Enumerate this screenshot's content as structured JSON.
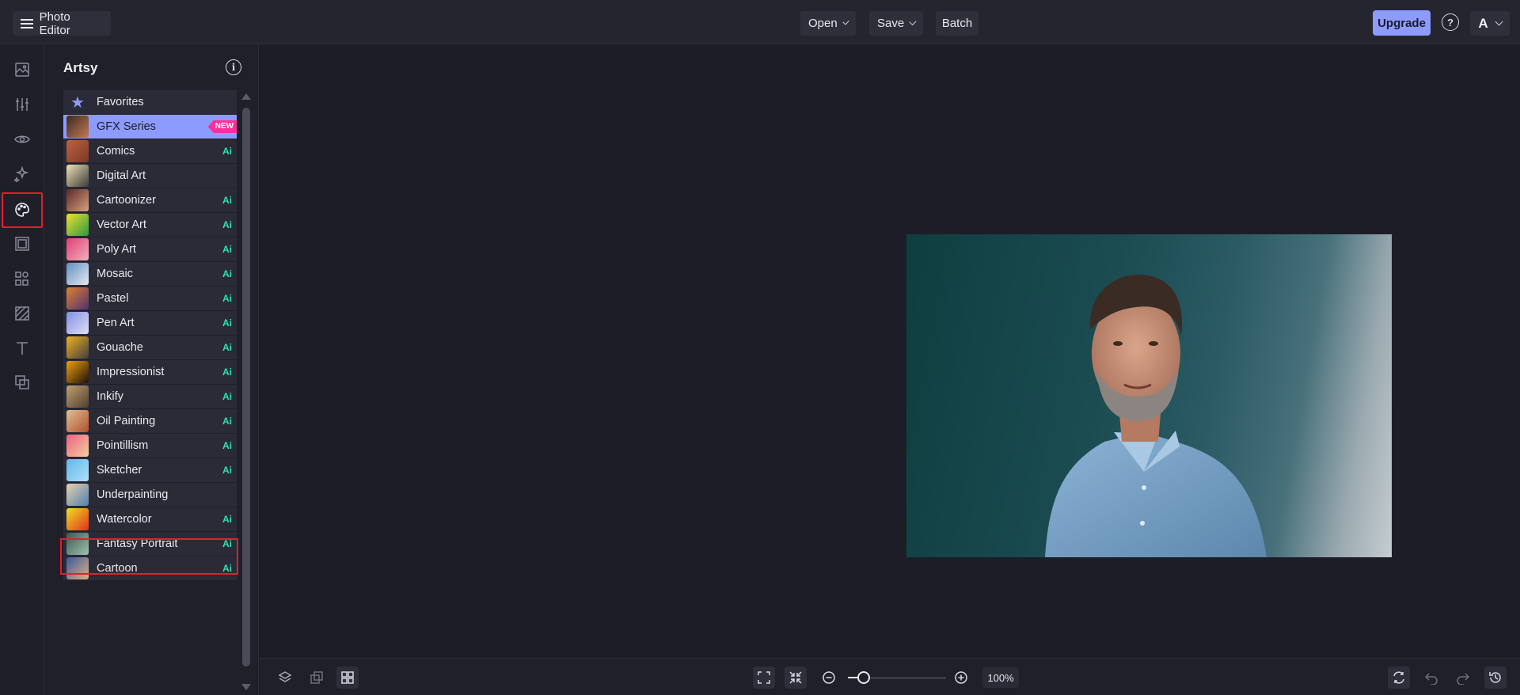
{
  "header": {
    "menu_label": "Photo Editor",
    "open_label": "Open",
    "save_label": "Save",
    "batch_label": "Batch",
    "upgrade_label": "Upgrade",
    "help_label": "?",
    "account_initial": "A"
  },
  "rail": {
    "icons": [
      "image-icon",
      "adjust-sliders-icon",
      "eye-icon",
      "sparkle-effects-icon",
      "artsy-palette-icon",
      "frame-icon",
      "graphics-icon",
      "texture-icon",
      "text-icon",
      "overlay-icon"
    ],
    "active": "artsy-palette-icon"
  },
  "panel": {
    "title": "Artsy",
    "info_label": "i",
    "items": [
      {
        "label": "Favorites",
        "badge": ""
      },
      {
        "label": "GFX Series",
        "badge": "NEW"
      },
      {
        "label": "Comics",
        "badge": "Ai"
      },
      {
        "label": "Digital Art",
        "badge": ""
      },
      {
        "label": "Cartoonizer",
        "badge": "Ai"
      },
      {
        "label": "Vector Art",
        "badge": "Ai"
      },
      {
        "label": "Poly Art",
        "badge": "Ai"
      },
      {
        "label": "Mosaic",
        "badge": "Ai"
      },
      {
        "label": "Pastel",
        "badge": "Ai"
      },
      {
        "label": "Pen Art",
        "badge": "Ai"
      },
      {
        "label": "Gouache",
        "badge": "Ai"
      },
      {
        "label": "Impressionist",
        "badge": "Ai"
      },
      {
        "label": "Inkify",
        "badge": "Ai"
      },
      {
        "label": "Oil Painting",
        "badge": "Ai"
      },
      {
        "label": "Pointillism",
        "badge": "Ai"
      },
      {
        "label": "Sketcher",
        "badge": "Ai"
      },
      {
        "label": "Underpainting",
        "badge": ""
      },
      {
        "label": "Watercolor",
        "badge": "Ai"
      },
      {
        "label": "Fantasy Portrait",
        "badge": "Ai"
      },
      {
        "label": "Cartoon",
        "badge": "Ai"
      }
    ],
    "selected_item": "GFX Series",
    "highlighted_item": "Sketcher"
  },
  "bottombar": {
    "zoom_value": "100%",
    "zoom_fraction": 0.16
  },
  "colors": {
    "accent": "#8d9bff",
    "ai_badge": "#2ee0b0",
    "new_badge": "#ff2e9a",
    "highlight_box": "#e0202c"
  }
}
